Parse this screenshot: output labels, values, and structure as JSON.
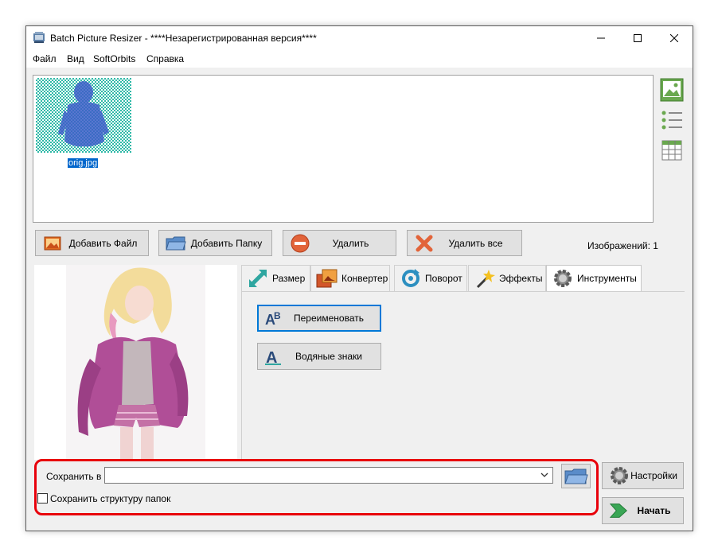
{
  "window": {
    "title": "Batch Picture Resizer - ****Незарегистрированная версия****",
    "controls": [
      "minimize",
      "maximize",
      "close"
    ]
  },
  "menu": [
    {
      "label": "Файл"
    },
    {
      "label": "Вид"
    },
    {
      "label": "SoftOrbits"
    },
    {
      "label": "Справка"
    }
  ],
  "file_list": {
    "items": [
      {
        "name": "orig.jpg",
        "selected": true
      }
    ]
  },
  "toolbar": {
    "add_file": "Добавить Файл",
    "add_folder": "Добавить Папку",
    "delete": "Удалить",
    "delete_all": "Удалить все",
    "images_count": "Изображений: 1"
  },
  "tabs": [
    {
      "label": "Размер",
      "icon": "resize-icon"
    },
    {
      "label": "Конвертер",
      "icon": "converter-icon"
    },
    {
      "label": "Поворот",
      "icon": "rotate-icon"
    },
    {
      "label": "Эффекты",
      "icon": "effects-icon"
    },
    {
      "label": "Инструменты",
      "icon": "gear-icon",
      "active": true
    }
  ],
  "tools": {
    "rename": "Переименовать",
    "watermark": "Водяные знаки"
  },
  "output": {
    "save_to_label": "Сохранить в",
    "save_to_value": "",
    "keep_structure_label": "Сохранить структуру папок",
    "keep_structure_checked": false
  },
  "actions": {
    "settings": "Настройки",
    "start": "Начать"
  },
  "colors": {
    "accent": "#0078d7",
    "highlight": "#e8000b",
    "selection": "#0066cc"
  }
}
